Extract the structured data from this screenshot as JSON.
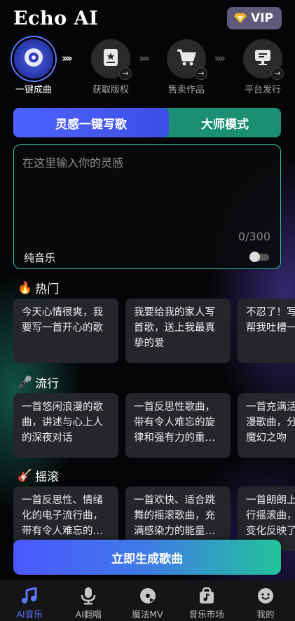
{
  "header": {
    "title": "Echo AI",
    "vip_label": "VIP"
  },
  "steps": [
    {
      "label": "一键成曲",
      "active": true
    },
    {
      "label": "获取版权",
      "active": false
    },
    {
      "label": "售卖作品",
      "active": false
    },
    {
      "label": "平台发行",
      "active": false
    }
  ],
  "step_separator": "››››",
  "mode_tabs": {
    "inspiration": "灵感一键写歌",
    "master": "大师模式"
  },
  "input": {
    "placeholder": "在这里输入你的灵感",
    "value": "",
    "counter": "0/300",
    "pure_music_label": "纯音乐",
    "pure_music_on": false
  },
  "sections": [
    {
      "title": "热门",
      "emoji": "🔥",
      "cards": [
        [
          "今天心情很爽，我",
          "要写一首开心的歌"
        ],
        [
          "我要给我的家人写",
          "首歌，送上我最真",
          "挚的爱"
        ],
        [
          "不忍了！写",
          "帮我吐槽一"
        ]
      ]
    },
    {
      "title": "流行",
      "emoji": "🎤",
      "cards": [
        [
          "一首悠闲浪漫的歌",
          "曲，讲述与心上人",
          "的深夜对话"
        ],
        [
          "一首反思性歌曲，",
          "带有令人难忘的旋",
          "律和强有力的重…"
        ],
        [
          "一首充满活",
          "漫歌曲，分",
          "魔幻之吻"
        ]
      ]
    },
    {
      "title": "摇滚",
      "emoji": "🎸",
      "cards": [
        [
          "一首反思性、情绪",
          "化的电子流行曲，",
          "带有令人难忘的…"
        ],
        [
          "一首欢快、适合跳",
          "舞的摇滚歌曲，充",
          "满感染力的能量…"
        ],
        [
          "一首朗朗上",
          "行摇滚曲，",
          "变化反映了"
        ]
      ]
    }
  ],
  "generate_button": "立即生成歌曲",
  "nav": [
    {
      "label": "AI音乐",
      "icon": "music-note-icon",
      "active": true
    },
    {
      "label": "AI翻唱",
      "icon": "microphone-icon",
      "active": false
    },
    {
      "label": "魔法MV",
      "icon": "video-disc-icon",
      "active": false
    },
    {
      "label": "音乐市场",
      "icon": "shopping-bag-icon",
      "active": false
    },
    {
      "label": "我的",
      "icon": "smiley-icon",
      "active": false
    }
  ],
  "colors": {
    "accent_blue": "#4d63ff",
    "accent_green": "#1b8f73",
    "input_border": "#29c9a3"
  }
}
